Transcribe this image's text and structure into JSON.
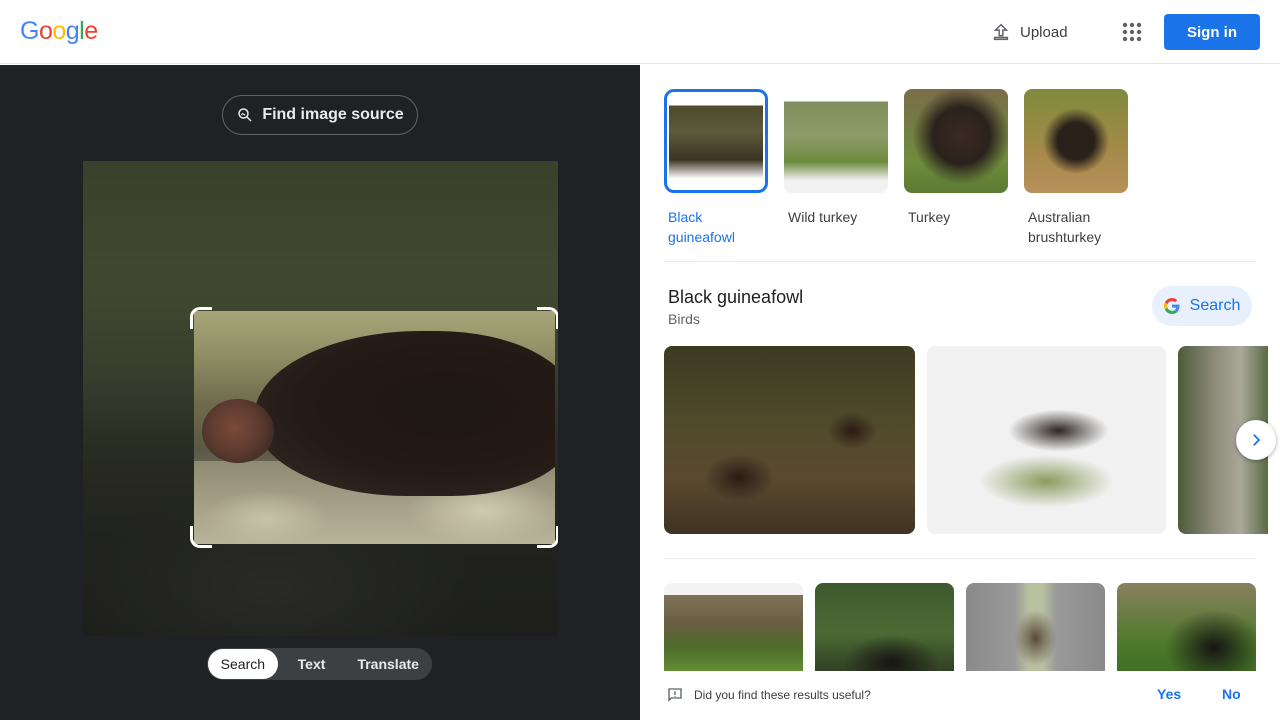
{
  "header": {
    "logo_letters": [
      "G",
      "o",
      "o",
      "g",
      "l",
      "e"
    ],
    "logo_colors": [
      "#4285F4",
      "#EA4335",
      "#FBBC05",
      "#4285F4",
      "#34A853",
      "#EA4335"
    ],
    "upload_label": "Upload",
    "upload_icon": "upload-icon",
    "apps_icon": "apps-grid-icon",
    "signin_label": "Sign in"
  },
  "left": {
    "find_source_label": "Find image source",
    "find_source_icon": "image-search-icon",
    "query_image": "blurry dark bird on ground",
    "tabs": [
      {
        "label": "Search",
        "active": true
      },
      {
        "label": "Text",
        "active": false
      },
      {
        "label": "Translate",
        "active": false
      }
    ]
  },
  "right": {
    "chips": [
      {
        "label": "Black guineafowl",
        "selected": true
      },
      {
        "label": "Wild turkey",
        "selected": false
      },
      {
        "label": "Turkey",
        "selected": false
      },
      {
        "label": "Australian brushturkey",
        "selected": false
      }
    ],
    "entity": {
      "title": "Black guineafowl",
      "subtitle": "Birds",
      "search_label": "Search"
    },
    "feedback": {
      "question": "Did you find these results useful?",
      "yes": "Yes",
      "no": "No"
    }
  },
  "colors": {
    "accent": "#1a73e8",
    "dark_panel": "#202124"
  }
}
